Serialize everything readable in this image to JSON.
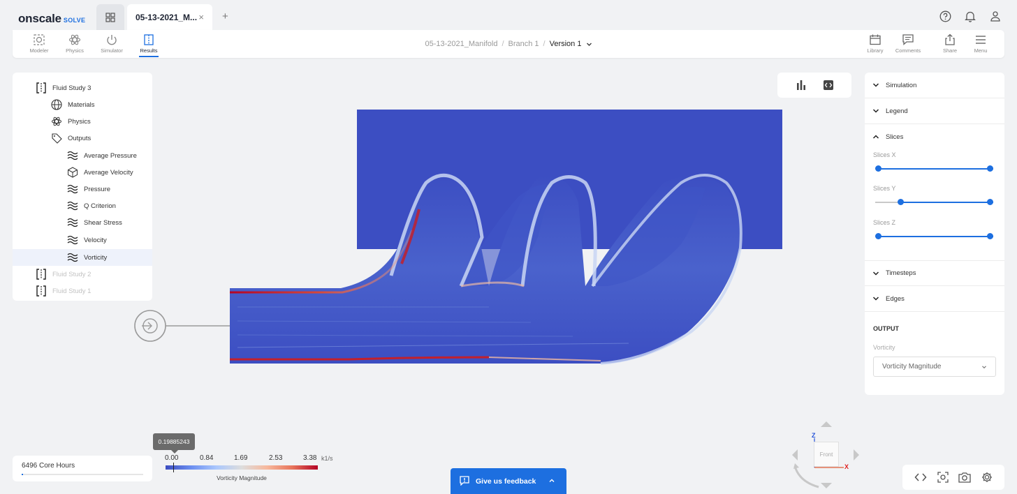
{
  "app": {
    "logo_main": "onscale",
    "logo_sub": "SOLVE",
    "tab_file": "05-13-2021_M...",
    "tab_close": "×",
    "tab_add": "+"
  },
  "toolbar": {
    "tools": [
      {
        "label": "Modeler",
        "icon": "modeler-icon"
      },
      {
        "label": "Physics",
        "icon": "atom-icon"
      },
      {
        "label": "Simulator",
        "icon": "power-icon"
      },
      {
        "label": "Results",
        "icon": "results-icon"
      }
    ],
    "right_tools": [
      {
        "label": "Library",
        "icon": "calendar-icon"
      },
      {
        "label": "Comments",
        "icon": "comment-icon"
      },
      {
        "label": "Share",
        "icon": "share-icon"
      },
      {
        "label": "Menu",
        "icon": "menu-icon"
      }
    ]
  },
  "breadcrumb": {
    "project": "05-13-2021_Manifold",
    "branch": "Branch 1",
    "version": "Version 1"
  },
  "tree": {
    "study": "Fluid Study 3",
    "materials": "Materials",
    "physics": "Physics",
    "outputs": "Outputs",
    "out_items": [
      "Average Pressure",
      "Average Velocity",
      "Pressure",
      "Q Criterion",
      "Shear Stress",
      "Velocity",
      "Vorticity"
    ],
    "study2": "Fluid Study 2",
    "study1": "Fluid Study 1"
  },
  "panel": {
    "simulation": "Simulation",
    "legend": "Legend",
    "slices": "Slices",
    "slices_x": "Slices X",
    "slices_y": "Slices Y",
    "slices_z": "Slices Z",
    "timesteps": "Timesteps",
    "edges": "Edges",
    "output_header": "OUTPUT",
    "output_label": "Vorticity",
    "output_select": "Vorticity Magnitude"
  },
  "sliders": {
    "x": [
      0.0,
      1.0
    ],
    "y": [
      0.2,
      1.0
    ],
    "z": [
      0.0,
      1.0
    ]
  },
  "hours": {
    "label": "6496 Core Hours",
    "fill": 0.01
  },
  "colorbar": {
    "tooltip": "0.19885243",
    "ticks": [
      "0.00",
      "0.84",
      "1.69",
      "2.53",
      "3.38"
    ],
    "unit": "k1/s",
    "title": "Vorticity Magnitude"
  },
  "feedback": {
    "label": "Give us feedback"
  },
  "cube": {
    "front": "Front",
    "z": "Z",
    "x": "X"
  },
  "colors": {
    "accent": "#1d6fe0",
    "domain_blue": "#3c4ec2",
    "hot_red": "#b40426"
  }
}
